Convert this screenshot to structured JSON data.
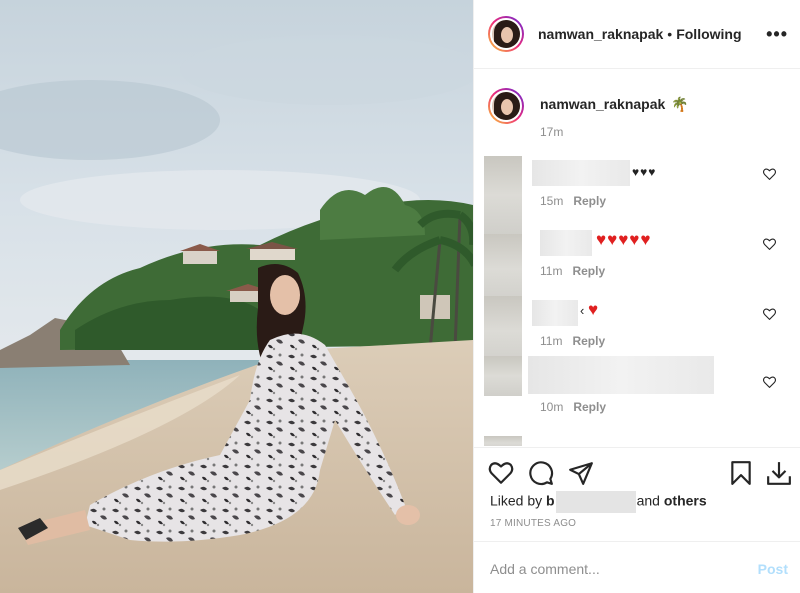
{
  "header": {
    "username": "namwan_raknapak",
    "separator": "•",
    "follow_status": "Following",
    "more": "•••"
  },
  "caption": {
    "username": "namwan_raknapak",
    "emoji": "🌴",
    "time": "17m"
  },
  "comments": [
    {
      "text_suffix": "♥♥♥",
      "time": "15m",
      "reply": "Reply"
    },
    {
      "text_suffix": "♥♥♥♥♥",
      "time": "11m",
      "reply": "Reply"
    },
    {
      "text_prefix": "‹",
      "text_suffix": "♥",
      "time": "11m",
      "reply": "Reply"
    },
    {
      "time": "10m",
      "reply": "Reply"
    }
  ],
  "actions": {
    "like": "heart-icon",
    "comment": "comment-icon",
    "share": "send-icon",
    "save": "bookmark-icon",
    "download": "download-icon"
  },
  "likes": {
    "prefix": "Liked by",
    "partial": "b",
    "connector": "and",
    "others": "others"
  },
  "timestamp": "17 MINUTES AGO",
  "add_comment": {
    "placeholder": "Add a comment...",
    "post": "Post"
  },
  "colors": {
    "text": "#262626",
    "muted": "#8e8e8e",
    "heart": "#e02020",
    "post_disabled": "#b2dffc"
  }
}
